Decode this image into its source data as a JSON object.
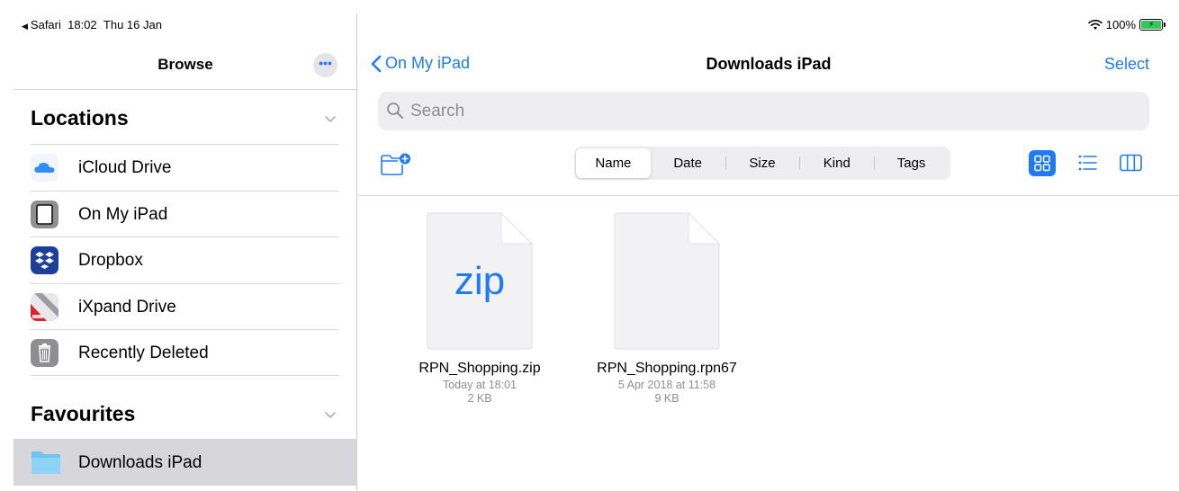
{
  "status_bar": {
    "back_app": "Safari",
    "time": "18:02",
    "date": "Thu 16 Jan",
    "battery": "100%"
  },
  "sidebar": {
    "title": "Browse",
    "more_label": "•••",
    "locations": {
      "heading": "Locations",
      "items": [
        {
          "label": "iCloud Drive",
          "icon": "icloud-icon"
        },
        {
          "label": "On My iPad",
          "icon": "ipad-icon"
        },
        {
          "label": "Dropbox",
          "icon": "dropbox-icon"
        },
        {
          "label": "iXpand Drive",
          "icon": "ixpand-icon"
        },
        {
          "label": "Recently Deleted",
          "icon": "trash-icon"
        }
      ]
    },
    "favourites": {
      "heading": "Favourites",
      "items": [
        {
          "label": "Downloads iPad",
          "icon": "folder-icon",
          "selected": true
        }
      ]
    }
  },
  "main": {
    "back_label": "On My iPad",
    "title": "Downloads iPad",
    "select_label": "Select",
    "search_placeholder": "Search",
    "sort_options": [
      "Name",
      "Date",
      "Size",
      "Kind",
      "Tags"
    ],
    "sort_selected": "Name",
    "view_mode": "grid",
    "files": [
      {
        "name": "RPN_Shopping.zip",
        "date": "Today at 18:01",
        "size": "2 KB",
        "thumb_label": "zip"
      },
      {
        "name": "RPN_Shopping.rpn67",
        "date": "5 Apr 2018 at 11:58",
        "size": "9 KB",
        "thumb_label": ""
      }
    ]
  },
  "colors": {
    "accent": "#1f7bf5",
    "selected_row": "#d6d6db",
    "search_bg": "#eeeef0",
    "secondary_text": "#8e8e93"
  }
}
